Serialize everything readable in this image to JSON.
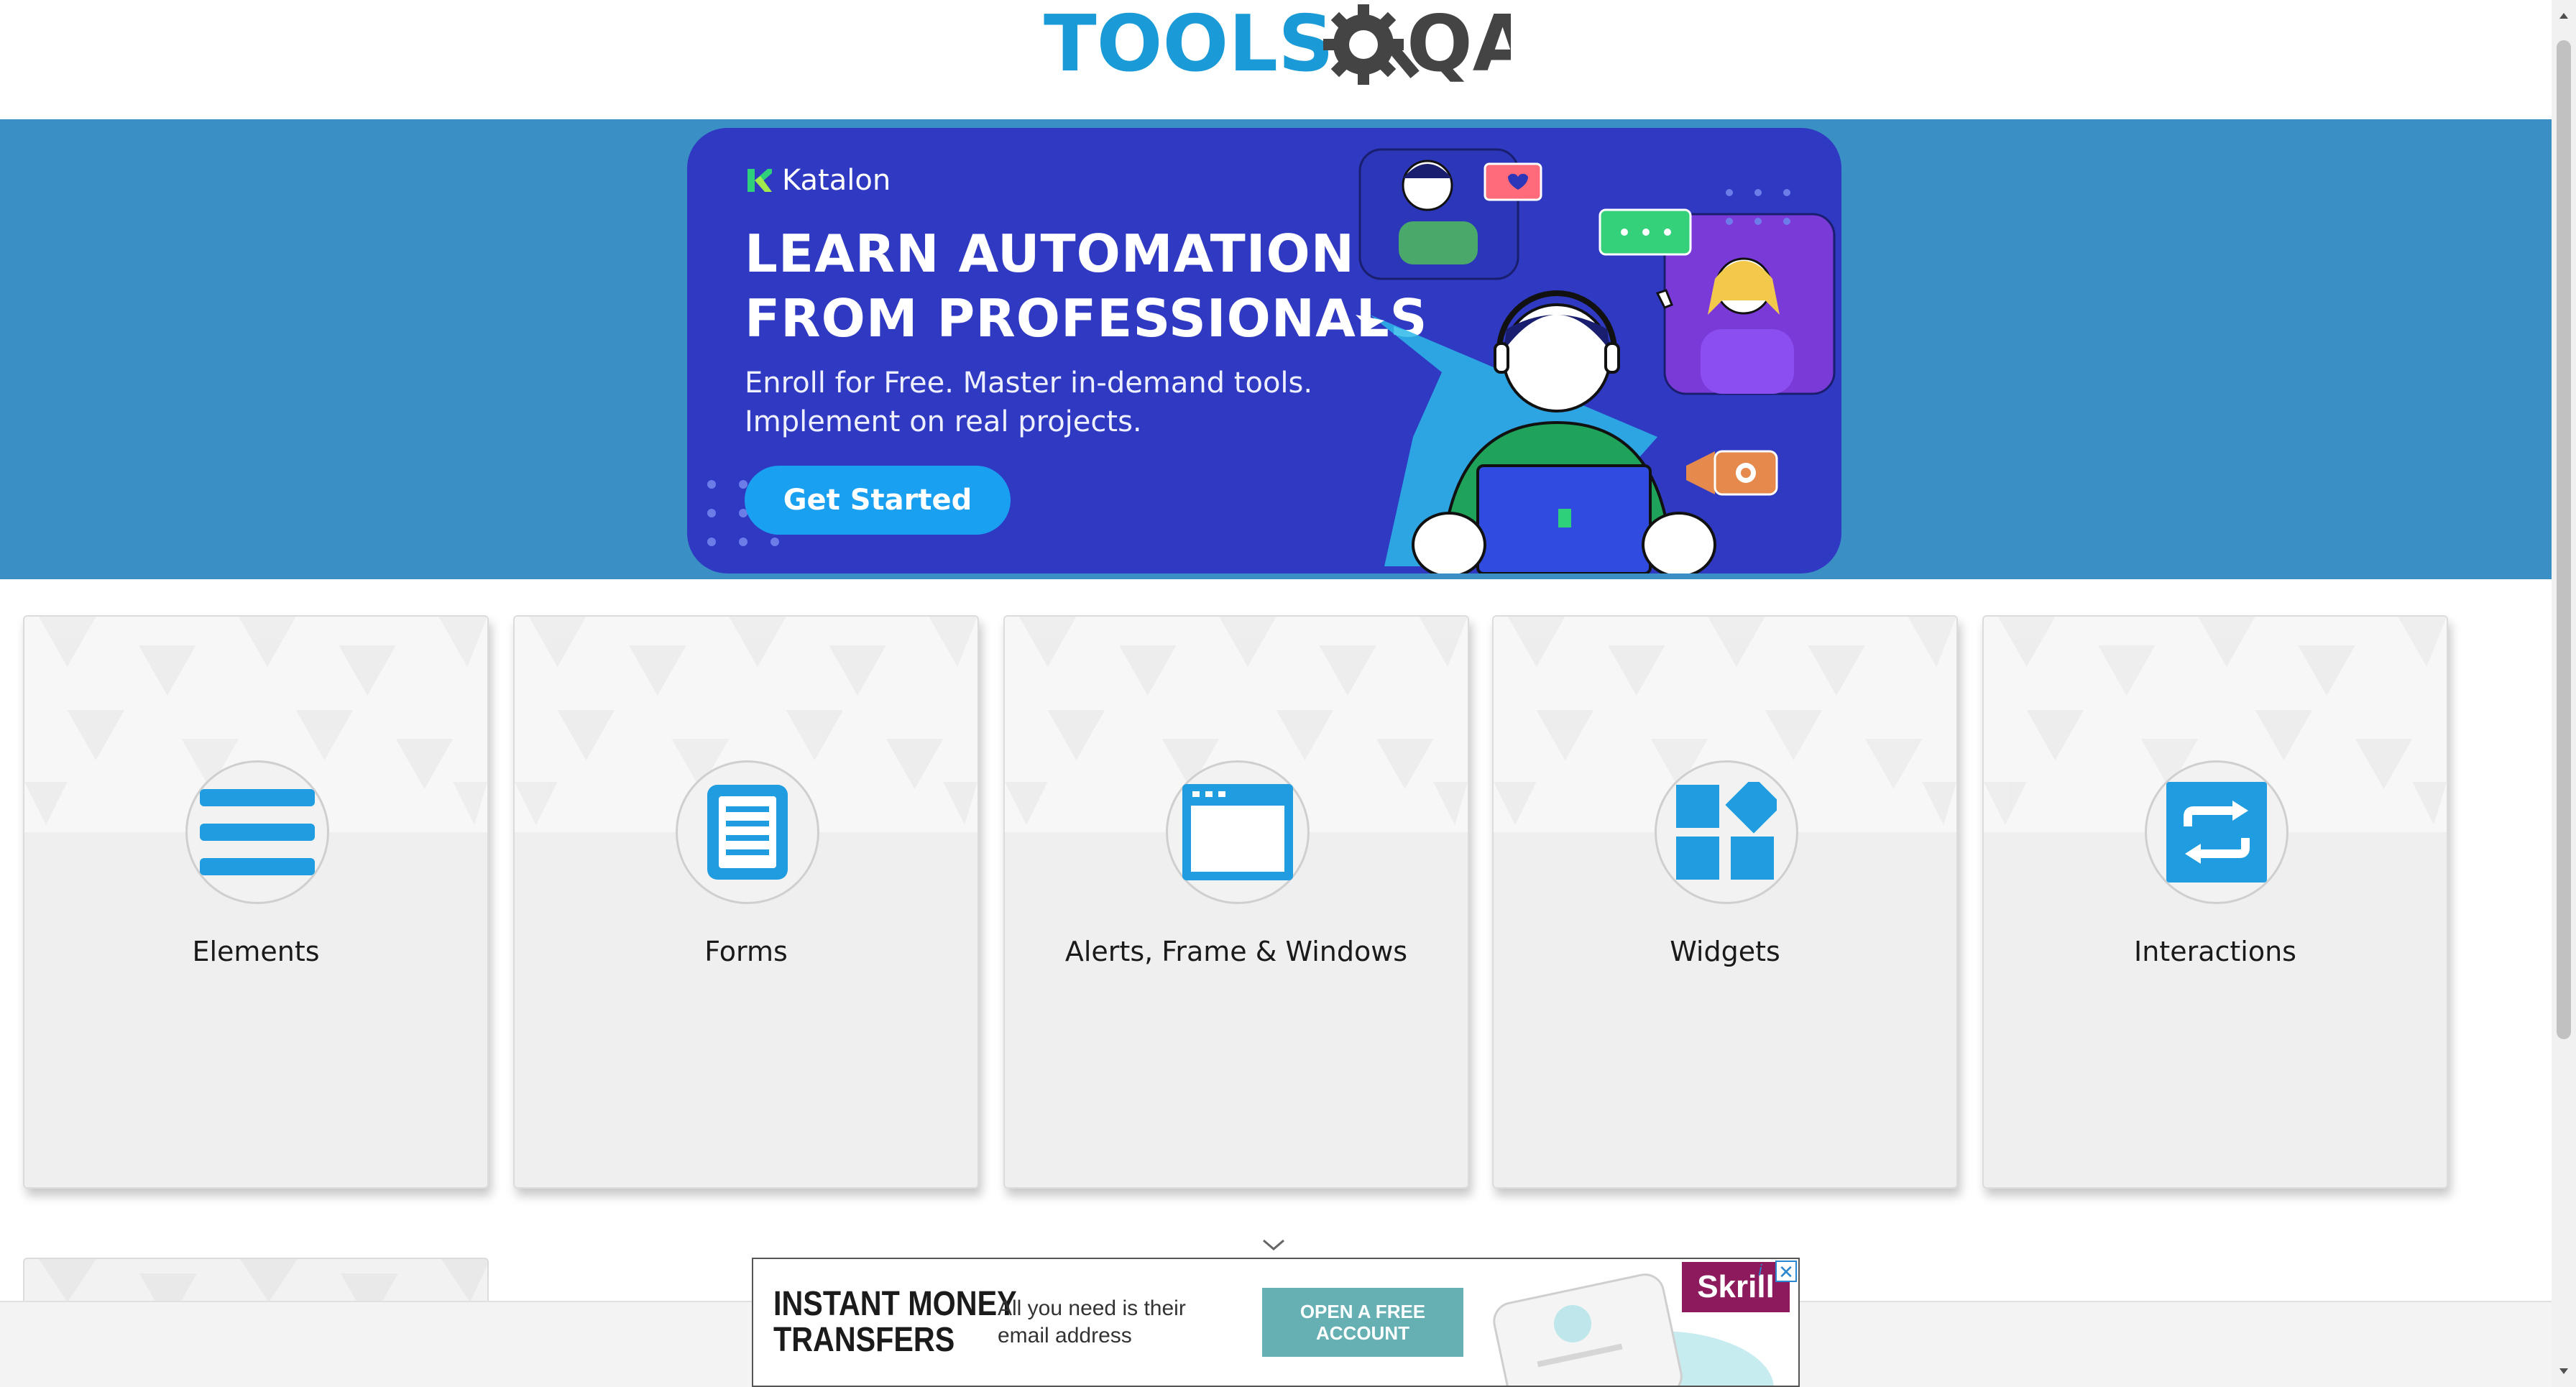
{
  "site": {
    "logo_text_tools": "TOOLS",
    "logo_text_qa": "QA"
  },
  "banner": {
    "brand": "Katalon",
    "headline_line1": "LEARN AUTOMATION",
    "headline_line2": "FROM PROFESSIONALS",
    "sub_line1": "Enroll for Free. Master in-demand tools.",
    "sub_line2": "Implement on real projects.",
    "cta_label": "Get Started"
  },
  "cards": [
    {
      "title": "Elements",
      "icon": "list-icon"
    },
    {
      "title": "Forms",
      "icon": "document-icon"
    },
    {
      "title": "Alerts, Frame & Windows",
      "icon": "browser-window-icon"
    },
    {
      "title": "Widgets",
      "icon": "widgets-icon"
    },
    {
      "title": "Interactions",
      "icon": "swap-arrows-icon"
    }
  ],
  "ad": {
    "title_line1": "INSTANT MONEY",
    "title_line2": "TRANSFERS",
    "subtitle": "All you need is their email address",
    "button_label": "OPEN A FREE ACCOUNT",
    "brand": "Skrill"
  },
  "colors": {
    "accent": "#1f9de0",
    "banner_bg": "#3a8fc5",
    "banner_card": "#2f39c2",
    "cta": "#1aa0f0"
  }
}
